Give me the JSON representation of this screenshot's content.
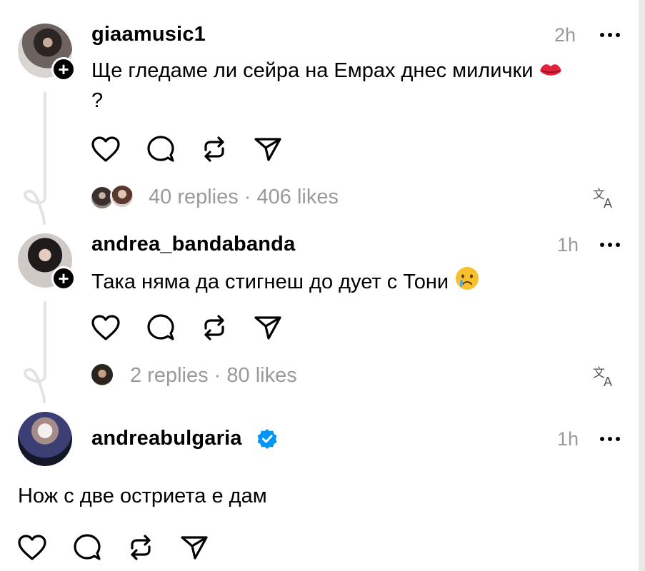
{
  "posts": [
    {
      "username": "giaamusic1",
      "time": "2h",
      "text": "Ще гледаме ли сейра на Емрах днес милички",
      "text_line2": "?",
      "emoji": "kiss-lips-emoji",
      "meta": "40 replies · 406 likes"
    },
    {
      "username": "andrea_bandabanda",
      "time": "1h",
      "text": "Така няма да стигнеш до дует с Тони",
      "emoji": "crying-face-emoji",
      "meta": "2 replies · 80 likes"
    },
    {
      "username": "andreabulgaria",
      "time": "1h",
      "verified": true,
      "text": "Нож с две остриета е дам"
    }
  ],
  "colors": {
    "muted": "#9a9a9a",
    "verified": "#0095f6",
    "thread_line": "#e3e3e3"
  }
}
